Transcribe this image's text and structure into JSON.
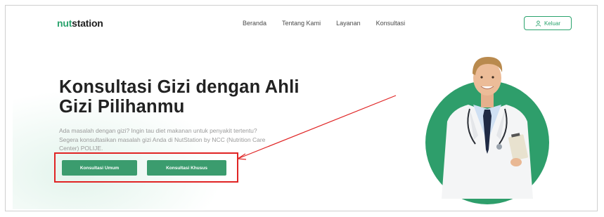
{
  "brand": {
    "logo_accent": "nut",
    "logo_rest": "station",
    "accent_color": "#2aa36d"
  },
  "nav": {
    "links": [
      "Beranda",
      "Tentang Kami",
      "Layanan",
      "Konsultasi"
    ],
    "logout_label": "Keluar",
    "logout_icon": "user-icon"
  },
  "hero": {
    "title_line1": "Konsultasi Gizi dengan Ahli",
    "title_line2": "Gizi Pilihanmu",
    "description_line1": "Ada masalah dengan gizi? Ingin tau diet makanan untuk penyakit tertentu?",
    "description_line2": "Segera konsultasikan masalah gizi Anda di NutStation by NCC (Nutrition Care",
    "description_line3": "Center) POLIJE.",
    "buttons": {
      "general": "Konsultasi Umum",
      "special": "Konsultasi Khusus"
    },
    "image_subject": "doctor-portrait"
  },
  "annotation": {
    "highlight_color": "#e02424"
  }
}
